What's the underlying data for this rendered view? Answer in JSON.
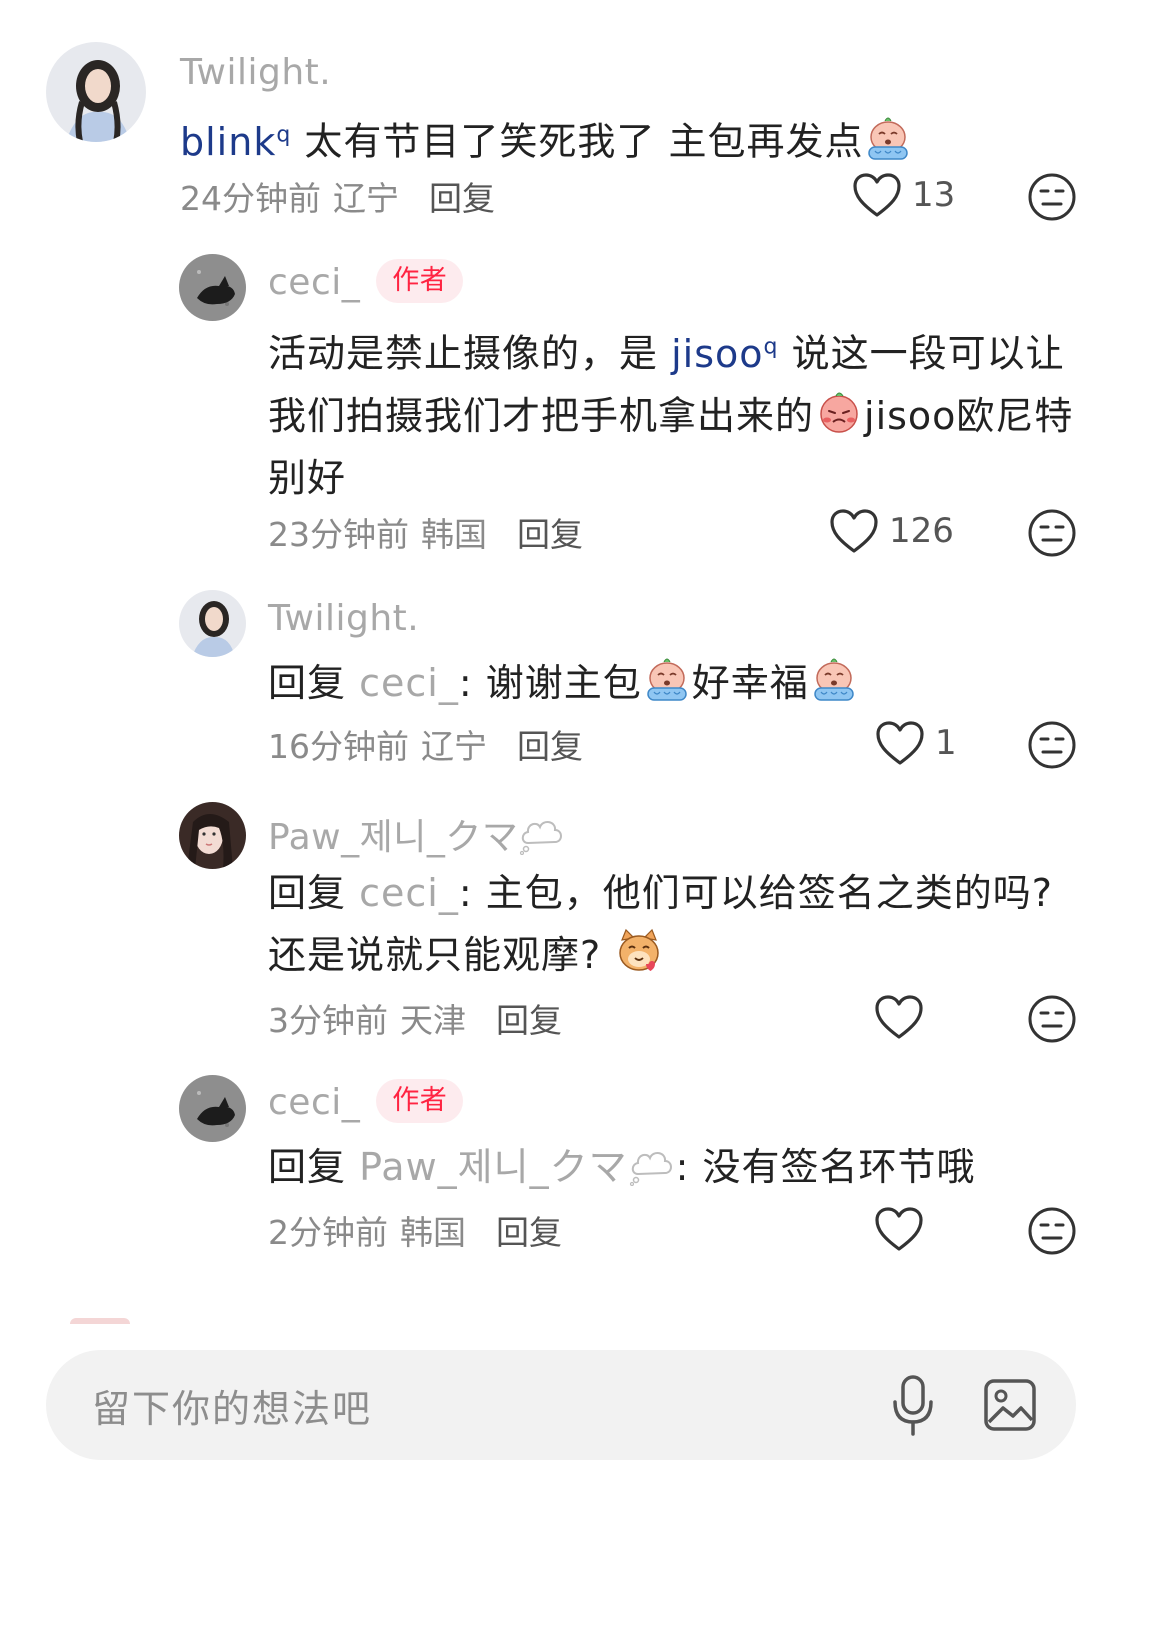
{
  "comments": [
    {
      "username": "Twilight.",
      "mention": "blink",
      "text": " 太有节目了笑死我了 主包再发点",
      "time": "24分钟前",
      "location": "辽宁",
      "reply_label": "回复",
      "likes": "13"
    },
    {
      "username": "ceci_",
      "badge": "作者",
      "text_a": "活动是禁止摄像的，是 ",
      "mention": "jisoo",
      "text_b": " 说这一段可以让",
      "line2": "我们拍摄我们才把手机拿出来的",
      "line2b": "jisoo欧尼特",
      "line3": "别好",
      "time": "23分钟前",
      "location": "韩国",
      "reply_label": "回复",
      "likes": "126"
    },
    {
      "username": "Twilight.",
      "prefix": "回复 ",
      "target": "ceci_",
      "text_a": ": 谢谢主包",
      "text_b": "好幸福",
      "time": "16分钟前",
      "location": "辽宁",
      "reply_label": "回复",
      "likes": "1"
    },
    {
      "username": "Paw_제니_クマ",
      "prefix": "回复 ",
      "target": "ceci_",
      "text_a": ": 主包，他们可以给签名之类的吗?",
      "line2": "还是说就只能观摩?",
      "time": "3分钟前",
      "location": "天津",
      "reply_label": "回复",
      "likes": ""
    },
    {
      "username": "ceci_",
      "badge": "作者",
      "prefix": "回复 ",
      "target": "Paw_제니_クマ",
      "text_a": ": 没有签名环节哦",
      "time": "2分钟前",
      "location": "韩国",
      "reply_label": "回复",
      "likes": ""
    }
  ],
  "input": {
    "placeholder": "留下你的想法吧",
    "mic_icon": "microphone-icon",
    "image_icon": "image-icon"
  },
  "colors": {
    "author_badge_bg": "#fdebee",
    "author_badge_text": "#ff2442",
    "mention": "#1d3a8a",
    "meta": "#8a8a8a"
  }
}
